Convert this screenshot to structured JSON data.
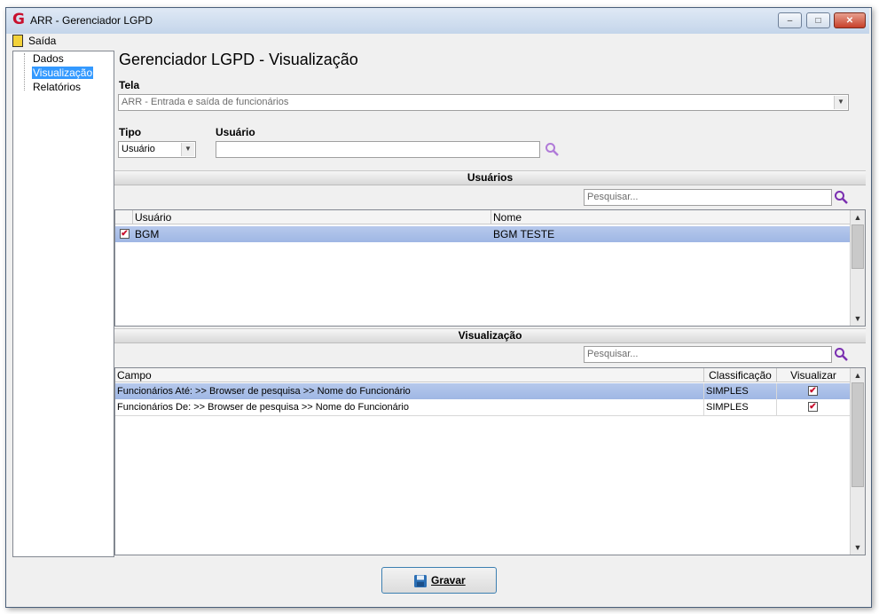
{
  "window": {
    "title": "ARR - Gerenciador LGPD",
    "app_icon_glyph": "G",
    "minimize_glyph": "–",
    "maximize_glyph": "□",
    "close_glyph": "✕"
  },
  "menu": {
    "items": [
      "Saída"
    ]
  },
  "tree": {
    "items": [
      "Dados",
      "Visualização",
      "Relatórios"
    ],
    "selected_index": 1
  },
  "header": {
    "title": "Gerenciador LGPD - Visualização"
  },
  "form": {
    "tela_label": "Tela",
    "tela_value": "ARR - Entrada e saída de funcionários",
    "tipo_label": "Tipo",
    "tipo_value": "Usuário",
    "usuario_label": "Usuário",
    "usuario_value": ""
  },
  "usuarios": {
    "section_title": "Usuários",
    "search_placeholder": "Pesquisar...",
    "columns": [
      "Usuário",
      "Nome"
    ],
    "rows": [
      {
        "checked": true,
        "usuario": "BGM",
        "nome": "BGM TESTE"
      }
    ]
  },
  "visualizacao": {
    "section_title": "Visualização",
    "search_placeholder": "Pesquisar...",
    "columns": [
      "Campo",
      "Classificação",
      "Visualizar"
    ],
    "rows": [
      {
        "campo": "Funcionários Até: >> Browser de pesquisa >> Nome do Funcionário",
        "classificacao": "SIMPLES",
        "visualizar": true
      },
      {
        "campo": "Funcionários De: >> Browser de pesquisa >> Nome do Funcionário",
        "classificacao": "SIMPLES",
        "visualizar": true
      }
    ]
  },
  "footer": {
    "save_label": "Gravar",
    "save_icon": "floppy-disk-icon"
  },
  "colors": {
    "accent": "#3399ff",
    "selected_row": "#9fb7e4",
    "check": "#c8102e",
    "search_icon": "#7a2fb0"
  }
}
